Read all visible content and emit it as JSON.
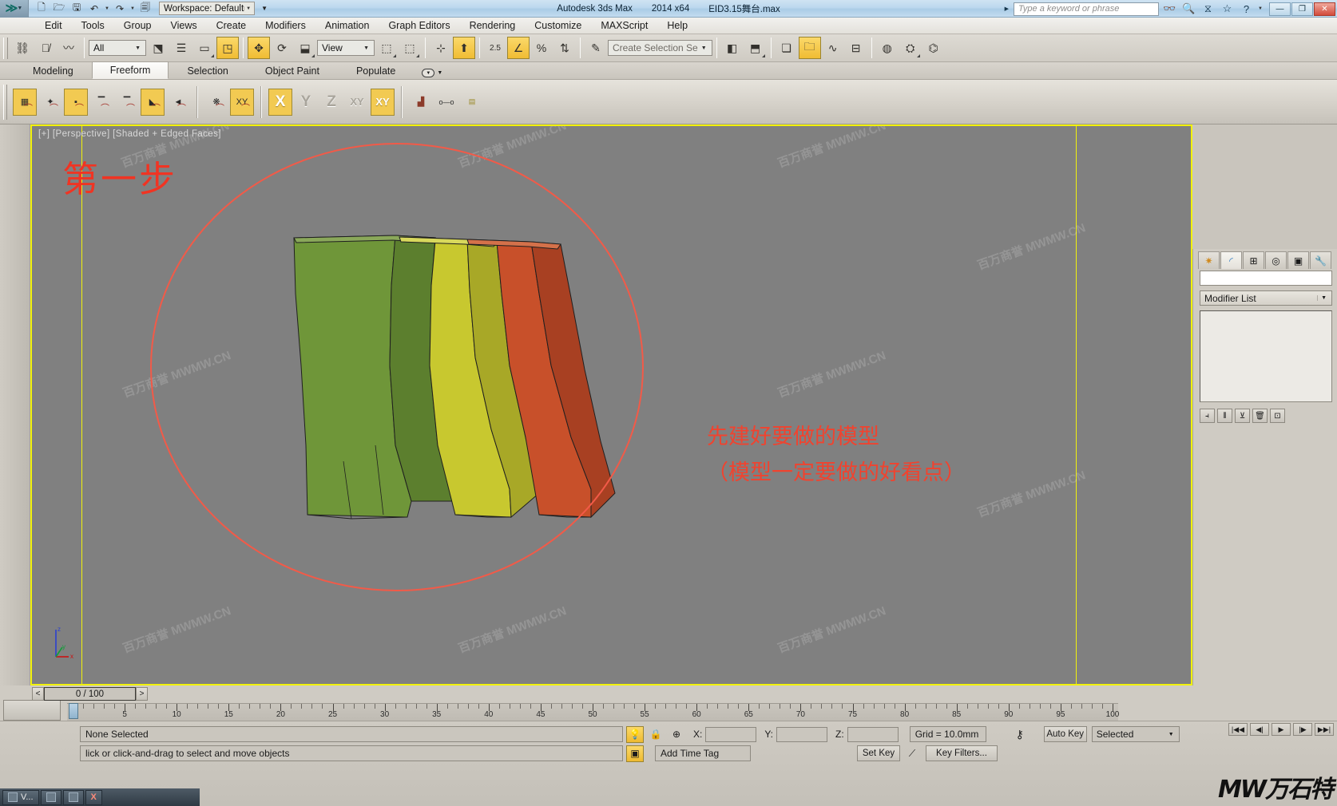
{
  "titlebar": {
    "app_name": "Autodesk 3ds Max",
    "version": "2014 x64",
    "file_name": "EID3.15舞台.max",
    "workspace_label": "Workspace: Default",
    "search_placeholder": "Type a keyword or phrase",
    "quick_access": [
      {
        "name": "new-file-icon",
        "glyph": "🗋"
      },
      {
        "name": "open-file-icon",
        "glyph": "🗁"
      },
      {
        "name": "save-file-icon",
        "glyph": "🖫"
      },
      {
        "name": "undo-icon",
        "glyph": "↶"
      },
      {
        "name": "redo-icon",
        "glyph": "↷"
      },
      {
        "name": "set-project-folder-icon",
        "glyph": "🗐"
      }
    ],
    "right_icons": [
      {
        "name": "binoculars-icon",
        "glyph": "👓"
      },
      {
        "name": "search-detail-icon",
        "glyph": "🔍"
      },
      {
        "name": "customer-involvement-icon",
        "glyph": "⧖"
      },
      {
        "name": "favorites-star-icon",
        "glyph": "☆"
      },
      {
        "name": "help-icon",
        "glyph": "?"
      }
    ],
    "window_buttons": [
      {
        "name": "minimize-button",
        "glyph": "—"
      },
      {
        "name": "maximize-button",
        "glyph": "❐"
      },
      {
        "name": "close-button",
        "glyph": "✕"
      }
    ]
  },
  "menubar": {
    "items": [
      "Edit",
      "Tools",
      "Group",
      "Views",
      "Create",
      "Modifiers",
      "Animation",
      "Graph Editors",
      "Rendering",
      "Customize",
      "MAXScript",
      "Help"
    ]
  },
  "main_toolbar": {
    "selection_filter_value": "All",
    "reference_coord_value": "View",
    "named_selection_placeholder": "Create Selection Se",
    "buttons": [
      {
        "name": "select-and-link-icon",
        "glyph": "⛓",
        "active": false
      },
      {
        "name": "unlink-selection-icon",
        "glyph": "⛓",
        "active": false
      },
      {
        "name": "bind-to-space-warp-icon",
        "glyph": "〰",
        "active": false
      },
      {
        "name": "select-object-icon",
        "glyph": "⬔",
        "active": false
      },
      {
        "name": "select-by-name-icon",
        "glyph": "☰",
        "active": false
      },
      {
        "name": "rectangular-selection-region-icon",
        "glyph": "▭",
        "active": false
      },
      {
        "name": "window-crossing-icon",
        "glyph": "◳",
        "active": true
      },
      {
        "name": "select-and-move-icon",
        "glyph": "✥",
        "active": true
      },
      {
        "name": "select-and-rotate-icon",
        "glyph": "⟳",
        "active": false
      },
      {
        "name": "select-and-scale-icon",
        "glyph": "⬓",
        "active": false
      },
      {
        "name": "use-pivot-point-center-icon",
        "glyph": "⊹",
        "active": false
      },
      {
        "name": "snaps-toggle-25-icon",
        "glyph": "2.5",
        "active": false
      },
      {
        "name": "angle-snap-toggle-icon",
        "glyph": "∠",
        "active": true
      },
      {
        "name": "percent-snap-toggle-icon",
        "glyph": "%",
        "active": false
      },
      {
        "name": "spinner-snap-toggle-icon",
        "glyph": "⇅",
        "active": false
      },
      {
        "name": "edit-named-selection-sets-icon",
        "glyph": "✎",
        "active": false
      },
      {
        "name": "mirror-icon",
        "glyph": "◧",
        "active": false
      },
      {
        "name": "align-icon",
        "glyph": "⬒",
        "active": false
      },
      {
        "name": "layer-manager-icon",
        "glyph": "❏",
        "active": false
      },
      {
        "name": "scene-explorer-icon",
        "glyph": "🗀",
        "active": true
      },
      {
        "name": "curve-editor-icon",
        "glyph": "∿",
        "active": false
      },
      {
        "name": "schematic-view-icon",
        "glyph": "⊟",
        "active": false
      },
      {
        "name": "material-editor-icon",
        "glyph": "◍",
        "active": false
      },
      {
        "name": "render-setup-icon",
        "glyph": "⛭",
        "active": false
      },
      {
        "name": "rendered-frame-window-icon",
        "glyph": "🫖",
        "active": false
      }
    ]
  },
  "ribbon": {
    "tabs": [
      {
        "label": "Modeling",
        "selected": false
      },
      {
        "label": "Freeform",
        "selected": true
      },
      {
        "label": "Selection",
        "selected": false
      },
      {
        "label": "Object Paint",
        "selected": false
      },
      {
        "label": "Populate",
        "selected": false
      }
    ],
    "panel_buttons": [
      {
        "name": "paint-on-surface-icon",
        "label": "",
        "state": "on"
      },
      {
        "name": "paint-snap-vertex-icon",
        "label": "✦",
        "state": "off"
      },
      {
        "name": "paint-snap-edge-icon",
        "label": "",
        "state": "on"
      },
      {
        "name": "paint-snap-face-icon",
        "label": "",
        "state": "off"
      },
      {
        "name": "paint-snap-grid-icon",
        "label": "",
        "state": "off"
      },
      {
        "name": "paint-snap-surface-icon",
        "label": "",
        "state": "on"
      },
      {
        "name": "paint-normal-icon",
        "label": "◄",
        "state": "off"
      },
      {
        "name": "paint-snowflake-icon",
        "label": "❋",
        "state": "off"
      },
      {
        "name": "paint-xy-plane-icon",
        "label": "XY",
        "state": "on"
      }
    ],
    "axis_buttons": [
      {
        "label": "X",
        "on": true
      },
      {
        "label": "Y",
        "on": false
      },
      {
        "label": "Z",
        "on": false
      },
      {
        "label": "XY",
        "on": false
      },
      {
        "label": "XY",
        "on": true
      }
    ],
    "extra_buttons": [
      {
        "name": "object-paint-brush-icon",
        "glyph": "🪣"
      },
      {
        "name": "paint-offset-icon",
        "glyph": "o—o"
      },
      {
        "name": "paint-scatter-icon",
        "glyph": "▤"
      }
    ]
  },
  "viewport": {
    "label": "[+] [Perspective] [Shaded + Edged Faces]",
    "annotation_title": "第一步",
    "annotation_line1": "先建好要做的模型",
    "annotation_line2": "（模型一定要做的好看点）",
    "annotation_color": "#f0432f",
    "background_color": "#808080",
    "border_color": "#f2f20a",
    "axis_labels": [
      "z",
      "y",
      "x"
    ],
    "model_colors": [
      "#6f9639",
      "#c8c82f",
      "#c8502a"
    ]
  },
  "command_panel": {
    "tabs": [
      {
        "name": "create-tab",
        "glyph": "✷",
        "selected": false
      },
      {
        "name": "modify-tab",
        "glyph": "◜",
        "selected": true
      },
      {
        "name": "hierarchy-tab",
        "glyph": "⊞",
        "selected": false
      },
      {
        "name": "motion-tab",
        "glyph": "◎",
        "selected": false
      },
      {
        "name": "display-tab",
        "glyph": "▣",
        "selected": false
      },
      {
        "name": "utilities-tab",
        "glyph": "🔧",
        "selected": false
      }
    ],
    "object_name_value": "",
    "modifier_list_label": "Modifier List",
    "stack_buttons": [
      {
        "name": "pin-stack-icon",
        "glyph": "⫞"
      },
      {
        "name": "show-end-result-icon",
        "glyph": "⦀"
      },
      {
        "name": "make-unique-icon",
        "glyph": "⊻"
      },
      {
        "name": "remove-modifier-icon",
        "glyph": "🗑"
      },
      {
        "name": "configure-modifier-sets-icon",
        "glyph": "⊡"
      }
    ]
  },
  "timeline": {
    "prev_frame_label": "<",
    "next_frame_label": ">",
    "current_frame": "0 / 100",
    "ruler_labels": [
      "0",
      "5",
      "10",
      "15",
      "20",
      "25",
      "30",
      "35",
      "40",
      "45",
      "50",
      "55",
      "60",
      "65",
      "70",
      "75",
      "80",
      "85",
      "90",
      "95",
      "100"
    ],
    "range_start": 0,
    "range_end": 100
  },
  "statusbar": {
    "selection_status": "None Selected",
    "prompt": "lick or click-and-drag to select and move objects",
    "x_label": "X:",
    "x_value": "",
    "y_label": "Y:",
    "y_value": "",
    "z_label": "Z:",
    "z_value": "",
    "grid_label": "Grid = 10.0mm",
    "add_time_tag": "Add Time Tag",
    "auto_key": "Auto Key",
    "set_key": "Set Key",
    "key_mode_value": "Selected",
    "key_filters": "Key Filters...",
    "icons": [
      {
        "name": "isolate-selection-icon",
        "glyph": "💡",
        "lit": true
      },
      {
        "name": "selection-lock-icon",
        "glyph": "🔒",
        "lit": false
      },
      {
        "name": "absolute-relative-mode-icon",
        "glyph": "⊕",
        "lit": false
      }
    ],
    "nav_icons": [
      {
        "name": "go-to-start-icon",
        "glyph": "|◀◀"
      },
      {
        "name": "previous-frame-icon",
        "glyph": "◀|100"
      },
      {
        "name": "play-animation-icon",
        "glyph": "▶"
      },
      {
        "name": "next-frame-icon",
        "glyph": "00|▶"
      },
      {
        "name": "go-to-end-icon",
        "glyph": "▶▶|"
      }
    ],
    "brand_watermark": "MW万石特"
  },
  "taskbar": {
    "items": [
      {
        "name": "taskbar-item-viewport",
        "label": "V..."
      },
      {
        "name": "taskbar-icon-1",
        "label": ""
      },
      {
        "name": "taskbar-icon-2",
        "label": ""
      },
      {
        "name": "taskbar-item-close",
        "label": "X"
      }
    ]
  },
  "watermarks": [
    "MWMW.CN",
    "百万商誉 MWMW.CN"
  ]
}
